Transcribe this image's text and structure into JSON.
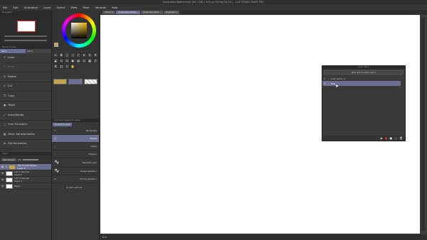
{
  "window": {
    "title": "Illustration(Reference)* (80 / 240 x 159 px 350dpi 33.3%) - CLIP STUDIO PAINT PRO"
  },
  "menu": [
    "File",
    "Edit",
    "Animation",
    "Layer",
    "Select",
    "View",
    "Filter",
    "Window",
    "Help"
  ],
  "navigator": {
    "title": "Navigator"
  },
  "quick_access": {
    "title": "Quick Access",
    "set": "Set 1",
    "set2": "Set 2",
    "items": [
      "Undo",
      "Redo",
      "Delete",
      "Cut",
      "Copy",
      "Paste",
      "Scale/Rotate",
      "Free Transform",
      "Mesh Transformation",
      "Flip Horizontal"
    ]
  },
  "colors": {
    "accent": "#6b6f92",
    "canvas": "#ffffff",
    "main_color": "#c4a44a",
    "sub_color": "#6e6f96"
  },
  "tool_property": {
    "title": "Sub Tool [Selection area]",
    "tab": "Selection area",
    "items": [
      "Rectangle",
      "Ellipse",
      "Lasso",
      "Polyline",
      "Selection pen",
      "Erase selection",
      "Shrink selection"
    ],
    "add": "Add sub tool"
  },
  "layers": {
    "title": "Layer",
    "blend": "Add (Glow)",
    "opacity": "100",
    "rows": [
      {
        "line1": "100 % Add (Glow)",
        "line2": "Layer 3"
      },
      {
        "line1": "100 % Normal",
        "line2": "Layer 2"
      },
      {
        "line1": "100 % Normal",
        "line2": "Layer 1"
      },
      {
        "line1": "",
        "line2": "Paper"
      }
    ]
  },
  "canvas_tabs": [
    "Illust (1)",
    "Illustration(Refer...",
    "Illustration(Ref...",
    "Illustration"
  ],
  "status": {
    "zoom": "33.3"
  },
  "auto_action": {
    "title": "Auto Action",
    "set": "New quick action set 1",
    "items": [
      "Auto action 1",
      "Test"
    ]
  }
}
